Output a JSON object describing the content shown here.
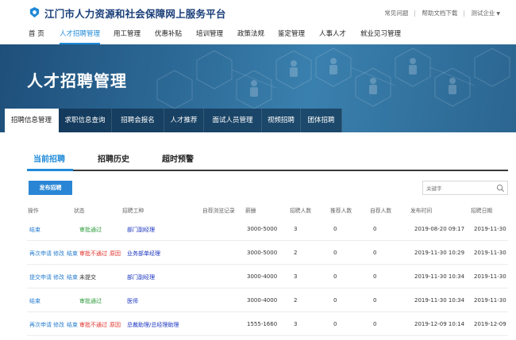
{
  "header": {
    "site_title": "江门市人力资源和社会保障网上服务平台",
    "links": [
      "常见问题",
      "帮助文档下载",
      "测试企业"
    ]
  },
  "nav": {
    "items": [
      "首 页",
      "人才招聘管理",
      "用工管理",
      "优惠补贴",
      "培训管理",
      "政策法规",
      "鉴定管理",
      "人事人才",
      "就业见习管理"
    ],
    "active_index": 1
  },
  "banner": {
    "title": "人才招聘管理"
  },
  "subnav": {
    "items": [
      "招聘信息管理",
      "求职信息查询",
      "招聘会报名",
      "人才推荐",
      "面试人员管理",
      "视频招聘",
      "团体招聘"
    ],
    "active_index": 0
  },
  "tabs": {
    "items": [
      "当前招聘",
      "招聘历史",
      "超时预警"
    ],
    "active_index": 0
  },
  "toolbar": {
    "publish_label": "发布招聘",
    "search_placeholder": "关键字",
    "search_icon": "search-icon"
  },
  "table": {
    "columns": [
      "操作",
      "状态",
      "招聘工种",
      "自荐浏览记录",
      "薪酬",
      "招聘人数",
      "推荐人数",
      "自荐人数",
      "发布时间",
      "招聘日期"
    ],
    "rows": [
      {
        "actions": [
          "结束"
        ],
        "status": "审批通过",
        "status_type": "green",
        "reason": "",
        "job": "部门副经理",
        "salary": "3000-5000",
        "hires": "3",
        "recommended": "0",
        "self": "0",
        "published": "2019-08-20 09:17",
        "date": "2019-11-30"
      },
      {
        "actions": [
          "再次申请",
          "修改",
          "结束"
        ],
        "status": "审批不通过",
        "status_type": "red",
        "reason": "原因",
        "job": "业务部单经理",
        "salary": "3000-5000",
        "hires": "2",
        "recommended": "0",
        "self": "0",
        "published": "2019-11-30 10:29",
        "date": "2019-11-30"
      },
      {
        "actions": [
          "提交申请",
          "修改",
          "结束"
        ],
        "status": "未提交",
        "status_type": "plain",
        "reason": "",
        "job": "部门副经理",
        "salary": "3000-4000",
        "hires": "3",
        "recommended": "0",
        "self": "0",
        "published": "2019-11-30 10:34",
        "date": "2019-11-30"
      },
      {
        "actions": [
          "结束"
        ],
        "status": "审批通过",
        "status_type": "green",
        "reason": "",
        "job": "医师",
        "salary": "3000-4000",
        "hires": "2",
        "recommended": "0",
        "self": "0",
        "published": "2019-11-30 10:34",
        "date": "2019-11-30"
      },
      {
        "actions": [
          "再次申请",
          "修改",
          "结束"
        ],
        "status": "审批不通过",
        "status_type": "red",
        "reason": "原因",
        "job": "总裁助理/总经理助理",
        "salary": "1555-1660",
        "hires": "3",
        "recommended": "0",
        "self": "0",
        "published": "2019-12-09 10:14",
        "date": "2019-12-09"
      }
    ]
  },
  "colors": {
    "accent": "#1f8ad8",
    "approved": "#2a9b3a",
    "rejected": "#e0302a",
    "job_link": "#1a35c0"
  }
}
